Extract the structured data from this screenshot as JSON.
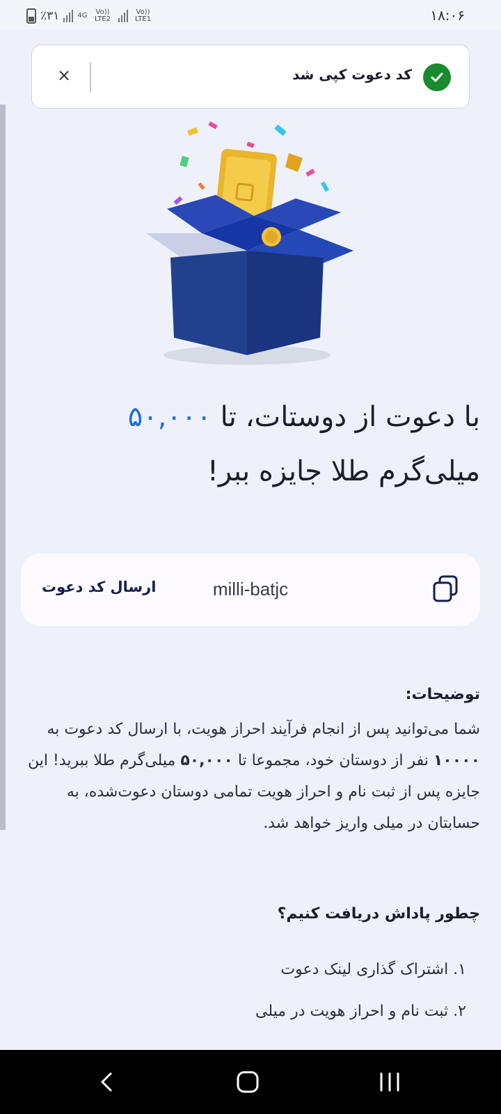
{
  "status_bar": {
    "time": "۱۸:۰۶",
    "battery": "٪۳۱",
    "network_1": "4G",
    "network_2": "Vo)) LTE2",
    "network_3": "Vo)) LTE1"
  },
  "toast": {
    "message": "کد دعوت کپی شد",
    "close_glyph": "×"
  },
  "headline": {
    "part1": "با دعوت از دوستات، تا ",
    "amount": "۵۰,۰۰۰",
    "part2": " میلی‌گرم طلا جایزه ببر!"
  },
  "invite": {
    "send_label": "ارسال کد دعوت",
    "code": "milli-batjc",
    "copy_icon": "copy-icon"
  },
  "description": {
    "title": "توضیحات:",
    "text_1": "شما می‌توانید پس از انجام فرآیند احراز هویت، با ارسال کد دعوت به ",
    "bold_count": "۱۰۰۰۰",
    "text_2": " نفر از دوستان خود، مجموعا تا ",
    "bold_amount": "۵۰,۰۰۰",
    "text_3": " میلی‌گرم طلا ببرید! این جایزه پس از ثبت نام و احراز هویت تمامی دوستان دعوت‌شده، به حسابتان در میلی واریز خواهد شد."
  },
  "how_to": {
    "title": "چطور پاداش دریافت کنیم؟",
    "steps": [
      "۱. اشتراک گذاری لینک دعوت",
      "۲. ثبت نام و احراز هویت در میلی"
    ]
  },
  "colors": {
    "accent": "#1f6fd6",
    "success": "#1a8a2f",
    "background": "#eef1fa"
  }
}
